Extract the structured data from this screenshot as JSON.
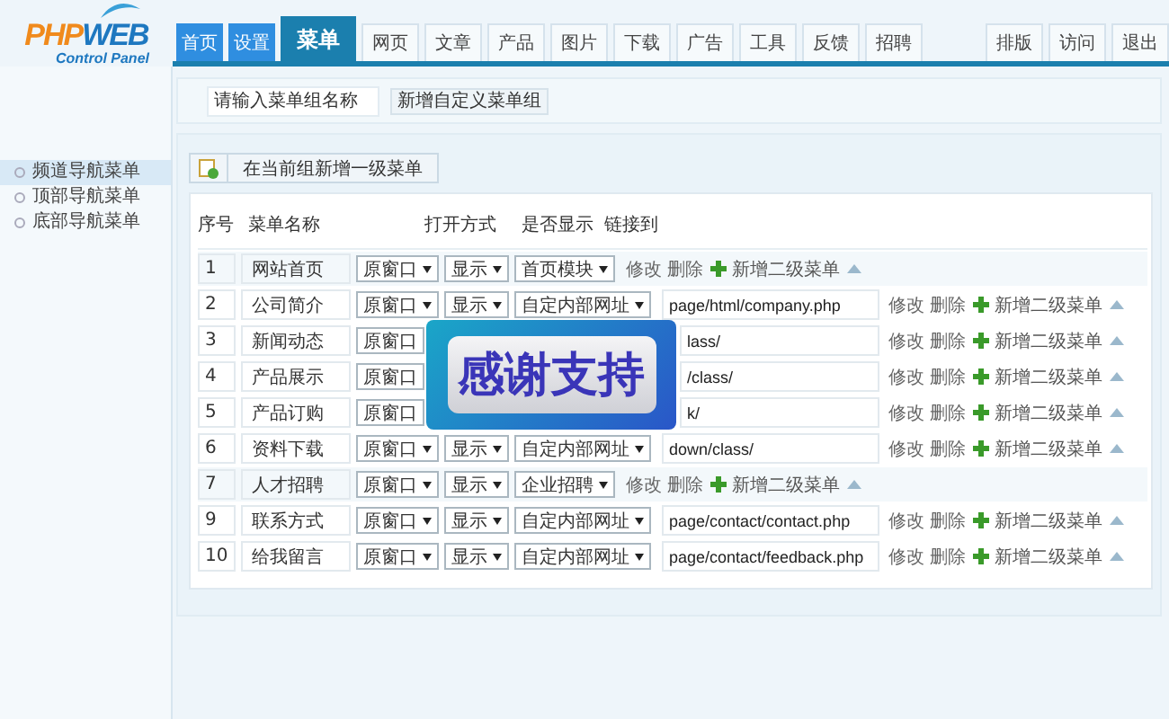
{
  "logo": {
    "first": "PHP",
    "second": "WEB",
    "subtitle": "Control Panel"
  },
  "tabs": [
    {
      "label": "首页",
      "selected": false,
      "kind": "quick"
    },
    {
      "label": "设置",
      "selected": false,
      "kind": "quick"
    },
    {
      "label": "菜单",
      "selected": true,
      "kind": "main"
    },
    {
      "label": "网页",
      "selected": false,
      "kind": "main"
    },
    {
      "label": "文章",
      "selected": false,
      "kind": "main"
    },
    {
      "label": "产品",
      "selected": false,
      "kind": "main"
    },
    {
      "label": "图片",
      "selected": false,
      "kind": "main"
    },
    {
      "label": "下载",
      "selected": false,
      "kind": "main"
    },
    {
      "label": "广告",
      "selected": false,
      "kind": "main"
    },
    {
      "label": "工具",
      "selected": false,
      "kind": "main"
    },
    {
      "label": "反馈",
      "selected": false,
      "kind": "main"
    },
    {
      "label": "招聘",
      "selected": false,
      "kind": "main"
    }
  ],
  "right_tabs": [
    "排版",
    "访问",
    "退出"
  ],
  "sidebar": {
    "items": [
      {
        "label": "频道导航菜单",
        "selected": true
      },
      {
        "label": "顶部导航菜单",
        "selected": false
      },
      {
        "label": "底部导航菜单",
        "selected": false
      }
    ]
  },
  "toolbar": {
    "group_name": "请输入菜单组名称",
    "add_group_button": "新增自定义菜单组"
  },
  "add_menu_button": "在当前组新增一级菜单",
  "table": {
    "columns": [
      "序号",
      "菜单名称",
      "打开方式",
      "是否显示",
      "链接到"
    ],
    "rows": [
      {
        "kind": "module",
        "num": "1",
        "name": "网站首页",
        "target": "原窗口",
        "show": "显示",
        "link_type": "首页模块",
        "edit": "修改",
        "delete": "删除",
        "add_sub": "新增二级菜单"
      },
      {
        "kind": "link",
        "num": "2",
        "name": "公司简介",
        "target": "原窗口",
        "show": "显示",
        "link_type": "自定内部网址",
        "link": "page/html/company.php",
        "edit": "修改",
        "delete": "删除",
        "add_sub": "新增二级菜单"
      },
      {
        "kind": "covered",
        "num": "3",
        "name": "新闻动态",
        "target": "原窗口",
        "link": "lass/",
        "edit": "修改",
        "delete": "删除",
        "add_sub": "新增二级菜单"
      },
      {
        "kind": "covered",
        "num": "4",
        "name": "产品展示",
        "target": "原窗口",
        "link": "/class/",
        "edit": "修改",
        "delete": "删除",
        "add_sub": "新增二级菜单"
      },
      {
        "kind": "covered",
        "num": "5",
        "name": "产品订购",
        "target": "原窗口",
        "link": "k/",
        "edit": "修改",
        "delete": "删除",
        "add_sub": "新增二级菜单"
      },
      {
        "kind": "link",
        "num": "6",
        "name": "资料下载",
        "target": "原窗口",
        "show": "显示",
        "link_type": "自定内部网址",
        "link": "down/class/",
        "edit": "修改",
        "delete": "删除",
        "add_sub": "新增二级菜单"
      },
      {
        "kind": "module",
        "num": "7",
        "name": "人才招聘",
        "target": "原窗口",
        "show": "显示",
        "link_type": "企业招聘",
        "edit": "修改",
        "delete": "删除",
        "add_sub": "新增二级菜单"
      },
      {
        "kind": "link",
        "num": "9",
        "name": "联系方式",
        "target": "原窗口",
        "show": "显示",
        "link_type": "自定内部网址",
        "link": "page/contact/contact.php",
        "edit": "修改",
        "delete": "删除",
        "add_sub": "新增二级菜单"
      },
      {
        "kind": "link",
        "num": "10",
        "name": "给我留言",
        "target": "原窗口",
        "show": "显示",
        "link_type": "自定内部网址",
        "link": "page/contact/feedback.php",
        "edit": "修改",
        "delete": "删除",
        "add_sub": "新增二级菜单"
      }
    ]
  },
  "overlay": {
    "text": "感谢支持"
  }
}
